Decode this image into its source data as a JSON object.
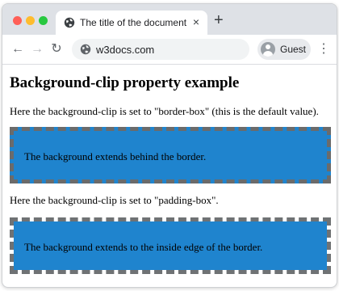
{
  "browser": {
    "tab": {
      "title": "The title of the document",
      "close_icon": "×",
      "favicon": "globe-icon"
    },
    "new_tab_label": "+",
    "toolbar": {
      "back_icon": "←",
      "forward_icon": "→",
      "reload_icon": "↻",
      "url": "w3docs.com",
      "profile_name": "Guest",
      "menu_icon": "⋮"
    }
  },
  "page": {
    "heading": "Background-clip property example",
    "examples": [
      {
        "description": "Here the background-clip is set to \"border-box\" (this is the default value).",
        "box_text": "The background extends behind the border."
      },
      {
        "description": "Here the background-clip is set to \"padding-box\".",
        "box_text": "The background extends to the inside edge of the border."
      }
    ]
  },
  "colors": {
    "box_background": "#1f84ce",
    "box_border": "#6b6b6b"
  }
}
